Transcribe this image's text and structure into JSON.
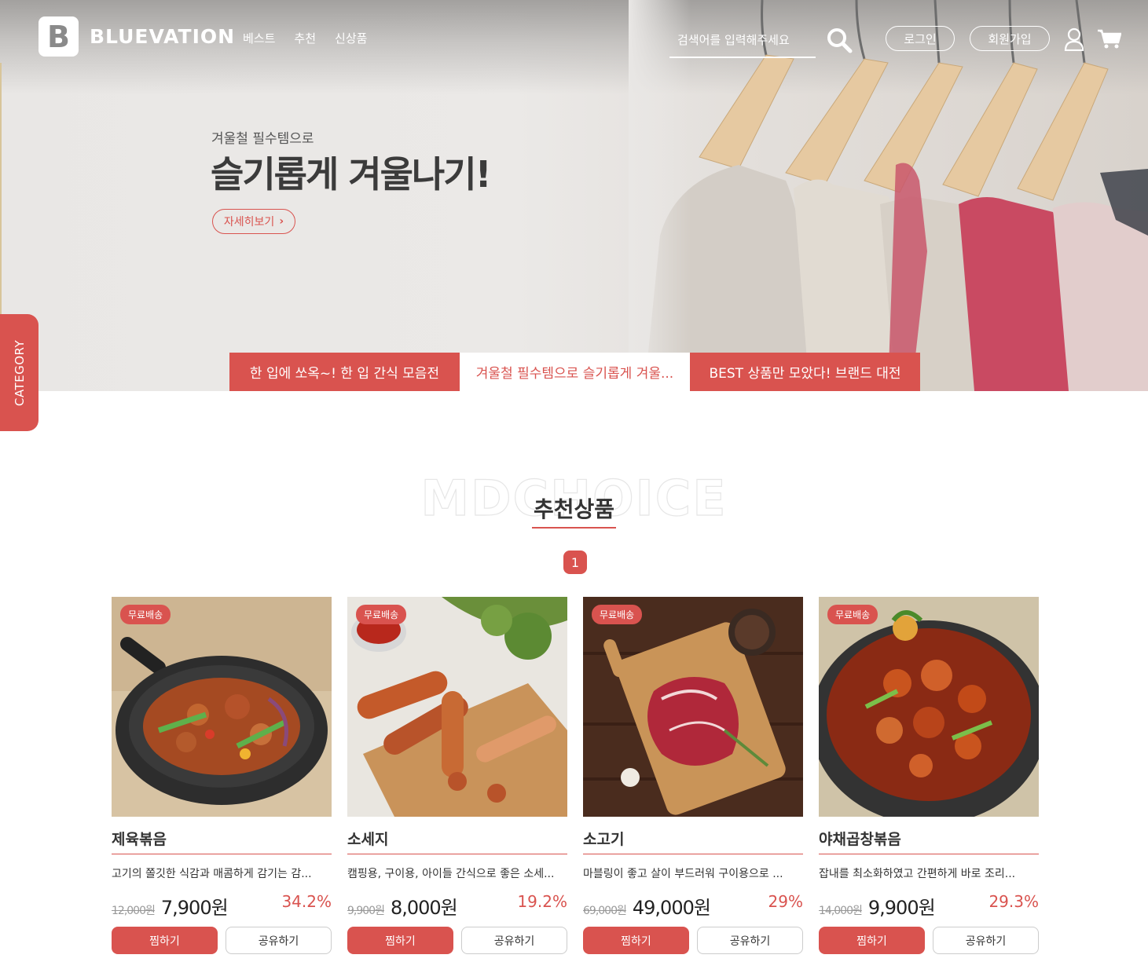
{
  "brand": {
    "logo_letter": "B",
    "name": "BLUEVATION"
  },
  "nav": [
    "베스트",
    "추천",
    "신상품"
  ],
  "search": {
    "placeholder": "검색어를 입력해주세요"
  },
  "account": {
    "login": "로그인",
    "join": "회원가입"
  },
  "hero": {
    "subtitle": "겨울철 필수템으로",
    "title": "슬기롭게 겨울나기!",
    "more": "자세히보기"
  },
  "tabs": [
    "한 입에 쏘옥~! 한 입 간식 모음전",
    "겨울철 필수템으로 슬기롭게 겨울...",
    "BEST 상품만 모았다! 브랜드 대전"
  ],
  "category_label": "CATEGORY",
  "section": {
    "bg_text": "MDCHOICE",
    "title": "추천상품",
    "page": "1"
  },
  "products": [
    {
      "badge": "무료배송",
      "name": "제육볶음",
      "desc": "고기의 쫄깃한 식감과 매콤하게 감기는 감...",
      "old_price": "12,000원",
      "price": "7,900원",
      "rate": "34.2%",
      "wish": "찜하기",
      "share": "공유하기"
    },
    {
      "badge": "무료배송",
      "name": "소세지",
      "desc": "캠핑용, 구이용, 아이들 간식으로 좋은 소세...",
      "old_price": "9,900원",
      "price": "8,000원",
      "rate": "19.2%",
      "wish": "찜하기",
      "share": "공유하기"
    },
    {
      "badge": "무료배송",
      "name": "소고기",
      "desc": "마블링이 좋고 살이 부드러워 구이용으로 ...",
      "old_price": "69,000원",
      "price": "49,000원",
      "rate": "29%",
      "wish": "찜하기",
      "share": "공유하기"
    },
    {
      "badge": "무료배송",
      "name": "야채곱창볶음",
      "desc": "잡내를 최소화하였고 간편하게 바로 조리...",
      "old_price": "14,000원",
      "price": "9,900원",
      "rate": "29.3%",
      "wish": "찜하기",
      "share": "공유하기"
    }
  ],
  "colors": {
    "accent": "#d9534f",
    "text": "#333333"
  }
}
